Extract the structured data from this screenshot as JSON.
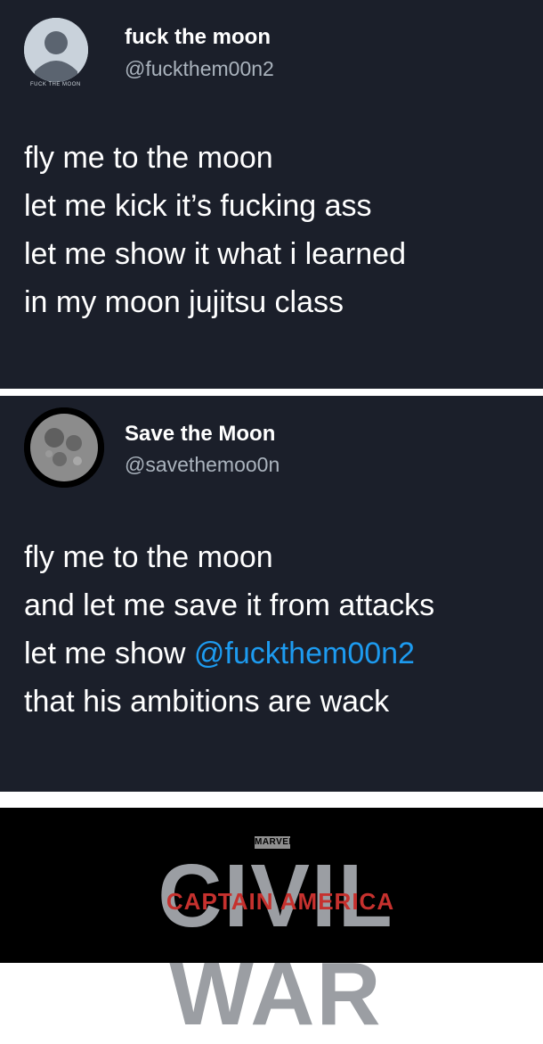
{
  "tweet1": {
    "display_name": "fuck the moon",
    "handle": "@fuckthem00n2",
    "avatar_text": "FUCK THE MOON",
    "lines": [
      "fly me to the moon",
      "let me kick it’s fucking ass",
      "let me show it what i learned",
      "in my moon jujitsu class"
    ]
  },
  "tweet2": {
    "display_name": "Save the Moon",
    "handle": "@savethemoo0n",
    "lines": [
      "fly me to the moon",
      "and let me save it from attacks",
      "let me show ",
      "that his ambitions are wack"
    ],
    "mention": "@fuckthem00n2"
  },
  "banner": {
    "marvel": "MARVEL",
    "title": "CIVIL WAR",
    "subtitle": "CAPTAIN AMERICA"
  }
}
